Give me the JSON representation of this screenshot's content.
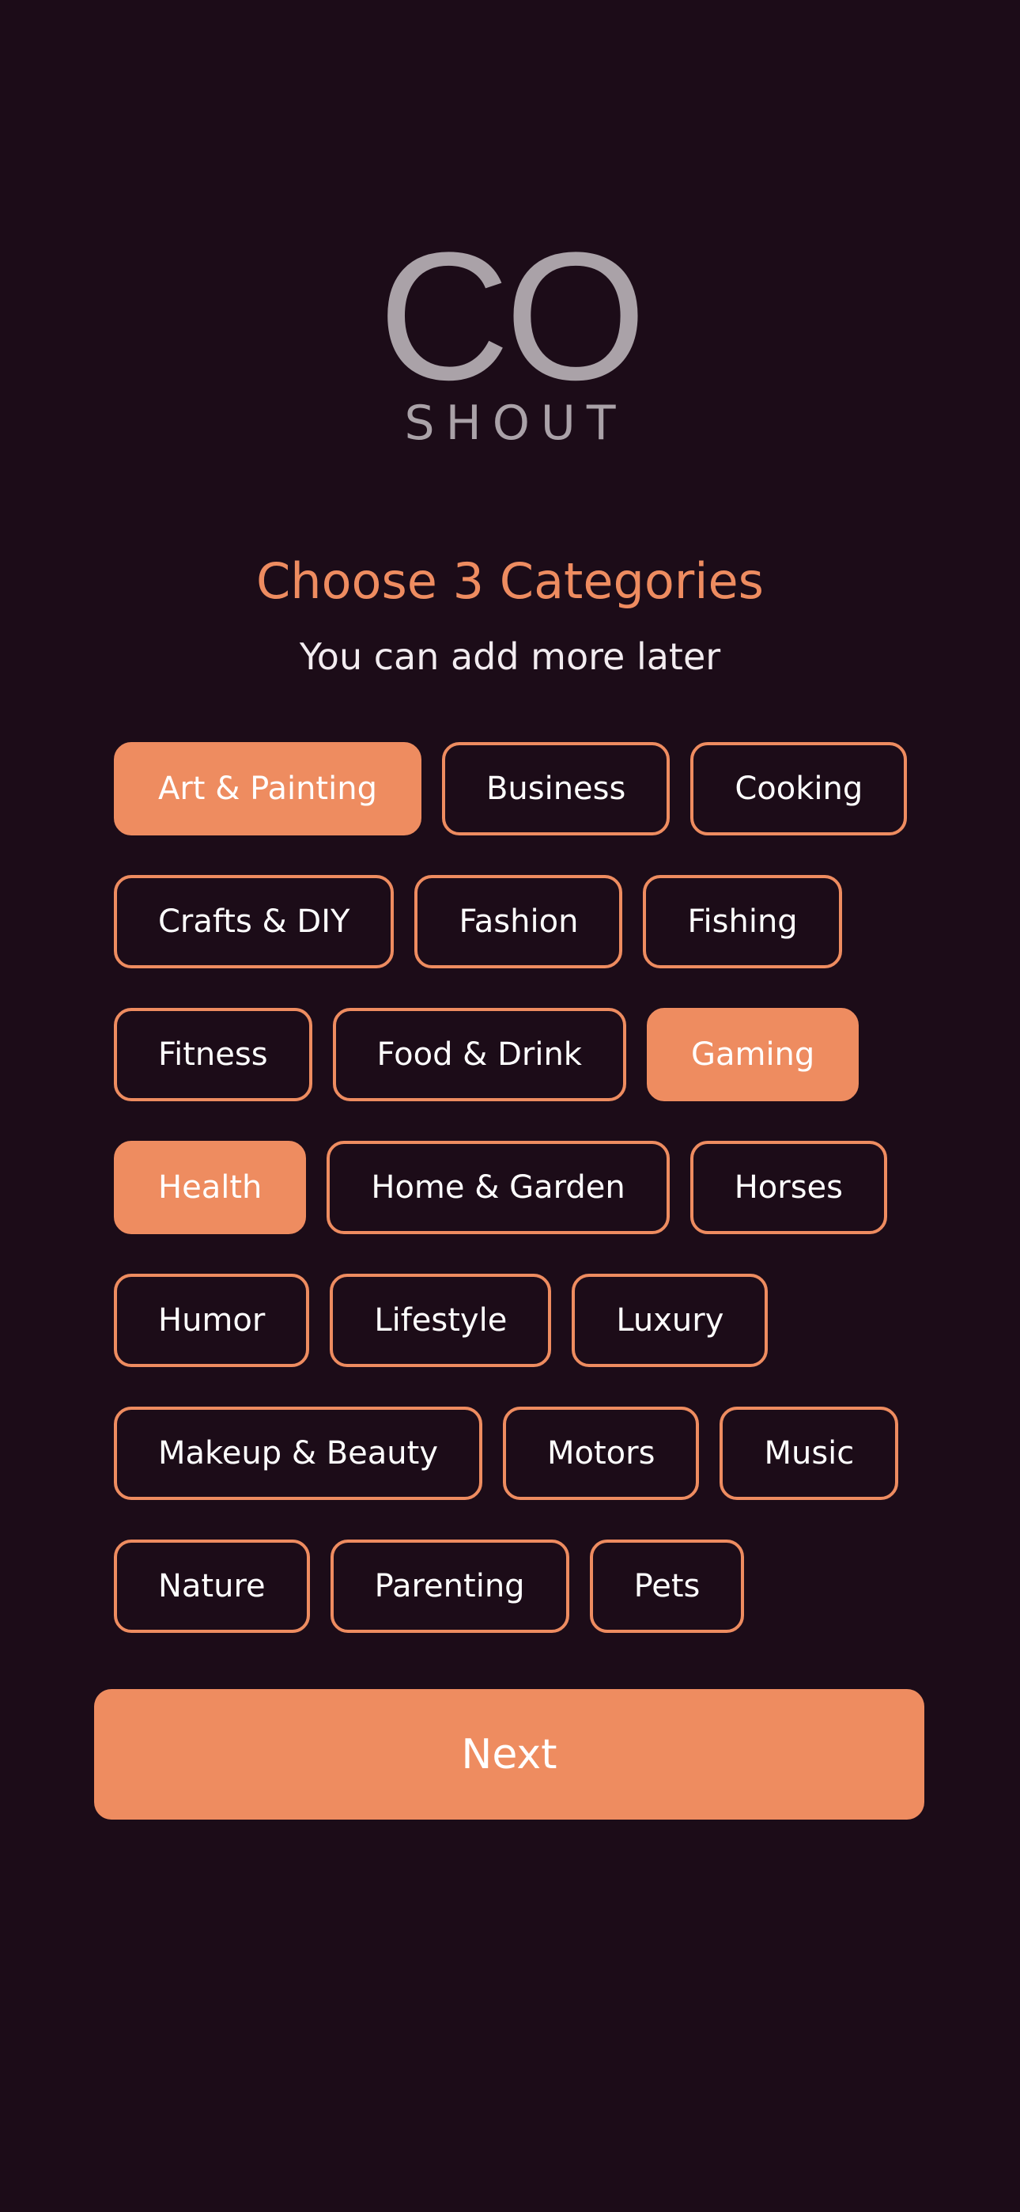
{
  "logo": {
    "main": "CO",
    "sub": "SHOUT"
  },
  "header": {
    "title": "Choose 3 Categories",
    "subtitle": "You can add more later"
  },
  "colors": {
    "background": "#1c0c18",
    "accent": "#ee8c60",
    "logo": "#aaa2a8"
  },
  "categories": [
    {
      "label": "Art & Painting",
      "selected": true
    },
    {
      "label": "Business",
      "selected": false
    },
    {
      "label": "Cooking",
      "selected": false
    },
    {
      "label": "Crafts & DIY",
      "selected": false
    },
    {
      "label": "Fashion",
      "selected": false
    },
    {
      "label": "Fishing",
      "selected": false
    },
    {
      "label": "Fitness",
      "selected": false
    },
    {
      "label": "Food & Drink",
      "selected": false
    },
    {
      "label": "Gaming",
      "selected": true
    },
    {
      "label": "Health",
      "selected": true
    },
    {
      "label": "Home & Garden",
      "selected": false
    },
    {
      "label": "Horses",
      "selected": false
    },
    {
      "label": "Humor",
      "selected": false
    },
    {
      "label": "Lifestyle",
      "selected": false
    },
    {
      "label": "Luxury",
      "selected": false
    },
    {
      "label": "Makeup & Beauty",
      "selected": false
    },
    {
      "label": "Motors",
      "selected": false
    },
    {
      "label": "Music",
      "selected": false
    },
    {
      "label": "Nature",
      "selected": false
    },
    {
      "label": "Parenting",
      "selected": false
    },
    {
      "label": "Pets",
      "selected": false
    }
  ],
  "footer": {
    "next_label": "Next"
  }
}
